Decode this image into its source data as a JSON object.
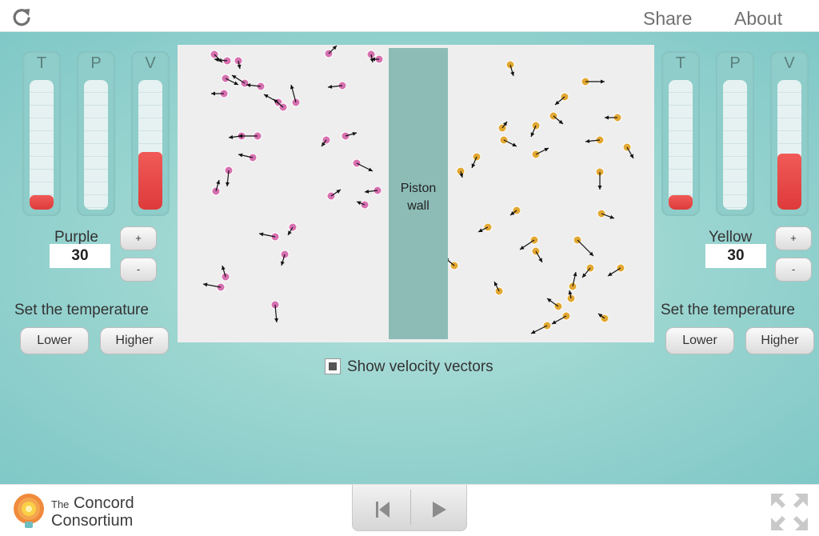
{
  "topbar": {
    "share": "Share",
    "about": "About",
    "reload_icon": "reload-icon"
  },
  "left": {
    "gauges": [
      {
        "label": "T",
        "level": 0.11
      },
      {
        "label": "P",
        "level": 0.0
      },
      {
        "label": "V",
        "level": 0.44
      }
    ],
    "gas_name": "Purple",
    "value": "30",
    "plus": "+",
    "minus": "-",
    "set_temp": "Set the temperature",
    "lower": "Lower",
    "higher": "Higher"
  },
  "right": {
    "gauges": [
      {
        "label": "T",
        "level": 0.11
      },
      {
        "label": "P",
        "level": 0.0
      },
      {
        "label": "V",
        "level": 0.43
      }
    ],
    "gas_name": "Yellow",
    "value": "30",
    "plus": "+",
    "minus": "-",
    "set_temp": "Set the temperature",
    "lower": "Lower",
    "higher": "Higher"
  },
  "simulation": {
    "piston_label_line1": "Piston",
    "piston_label_line2": "wall",
    "purple_color": "#d670b0",
    "yellow_color": "#e2a833"
  },
  "velocity_vectors": {
    "label": "Show velocity vectors",
    "checked": true
  },
  "footer": {
    "logo_line1_small": "The",
    "logo_line1": "Concord",
    "logo_line2": "Consortium",
    "reset_icon": "skip-back-icon",
    "play_icon": "play-icon",
    "fullscreen_icon": "fullscreen-icon"
  }
}
